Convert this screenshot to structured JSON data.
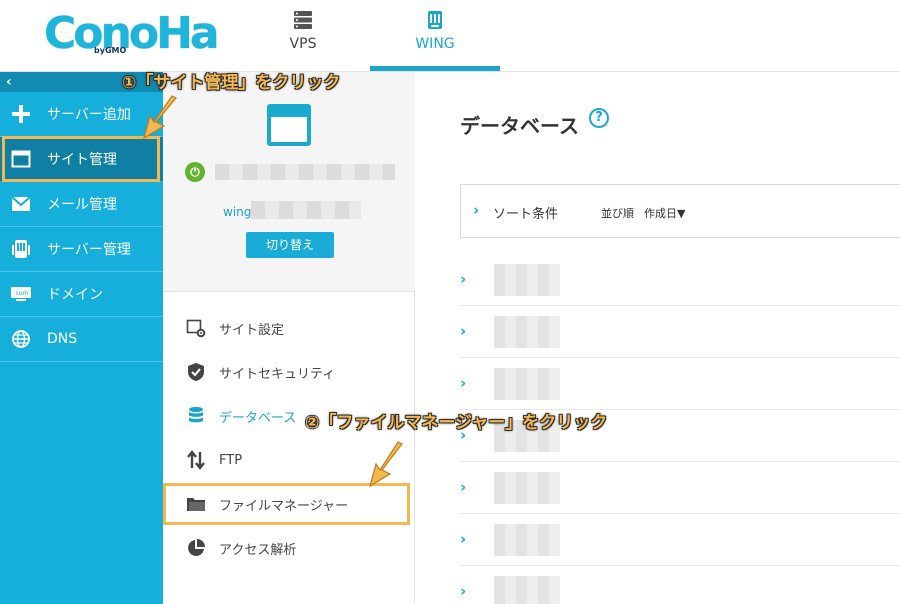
{
  "header": {
    "logo_text": "ConoHa",
    "logo_sub": "byGMO",
    "tabs": [
      {
        "label": "VPS",
        "icon": "server-icon"
      },
      {
        "label": "WING",
        "icon": "wing-icon",
        "active": true
      }
    ]
  },
  "sidebar": {
    "collapse_glyph": "‹",
    "items": [
      {
        "label": "サーバー追加",
        "icon": "plus-icon"
      },
      {
        "label": "サイト管理",
        "icon": "window-icon",
        "active": true
      },
      {
        "label": "メール管理",
        "icon": "mail-icon"
      },
      {
        "label": "サーバー管理",
        "icon": "server-rack-icon"
      },
      {
        "label": "ドメイン",
        "icon": "domain-com-icon"
      },
      {
        "label": "DNS",
        "icon": "globe-icon"
      }
    ]
  },
  "site_panel": {
    "account_prefix": "wing",
    "switch_button": "切り替え",
    "menu": [
      {
        "label": "サイト設定",
        "icon": "site-settings-icon"
      },
      {
        "label": "サイトセキュリティ",
        "icon": "shield-check-icon"
      },
      {
        "label": "データベース",
        "icon": "database-icon",
        "active": true
      },
      {
        "label": "FTP",
        "icon": "transfer-arrows-icon"
      },
      {
        "label": "ファイルマネージャー",
        "icon": "folder-icon"
      },
      {
        "label": "アクセス解析",
        "icon": "pie-chart-icon"
      }
    ]
  },
  "content": {
    "title": "データベース",
    "help_glyph": "?",
    "sort": {
      "label": "ソート条件",
      "order_label": "並び順",
      "order_value": "作成日▼"
    },
    "row_count": 7
  },
  "annotations": {
    "step1": "①「サイト管理」をクリック",
    "step2": "②「ファイルマネージャー」をクリック"
  },
  "colors": {
    "accent": "#1aa9cf",
    "sidebar_bg": "#16aedb",
    "sidebar_active": "#0f7fa3",
    "highlight": "#f5b850",
    "power_on": "#61b22f"
  }
}
